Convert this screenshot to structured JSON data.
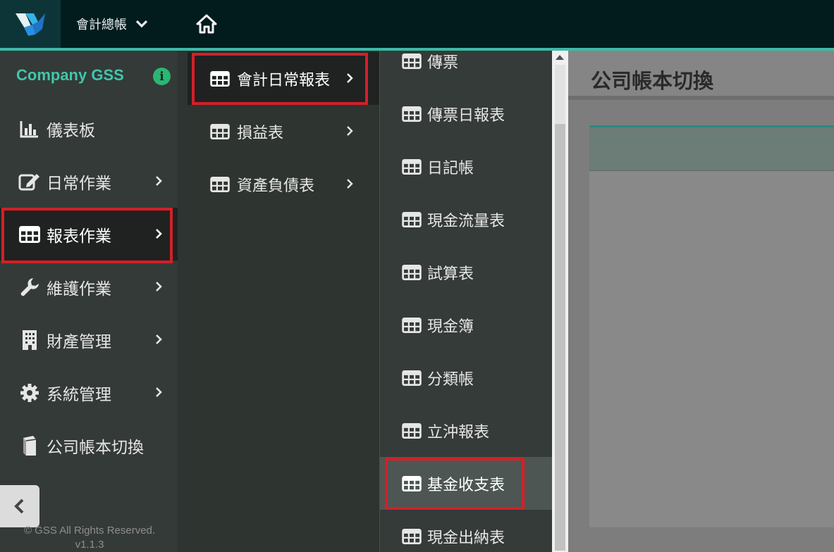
{
  "topbar": {
    "ledger_label": "會計總帳"
  },
  "sidebar": {
    "company": "Company GSS",
    "items": [
      {
        "label": "儀表板"
      },
      {
        "label": "日常作業"
      },
      {
        "label": "報表作業"
      },
      {
        "label": "維護作業"
      },
      {
        "label": "財產管理"
      },
      {
        "label": "系統管理"
      },
      {
        "label": "公司帳本切換"
      }
    ],
    "copyright": "© GSS All Rights Reserved.",
    "version": "v1.1.3"
  },
  "submenu": {
    "items": [
      {
        "label": "會計日常報表"
      },
      {
        "label": "損益表"
      },
      {
        "label": "資產負債表"
      }
    ]
  },
  "reports": {
    "items": [
      {
        "label": "傳票"
      },
      {
        "label": "傳票日報表"
      },
      {
        "label": "日記帳"
      },
      {
        "label": "現金流量表"
      },
      {
        "label": "試算表"
      },
      {
        "label": "現金簿"
      },
      {
        "label": "分類帳"
      },
      {
        "label": "立沖報表"
      },
      {
        "label": "基金收支表"
      },
      {
        "label": "現金出納表"
      }
    ]
  },
  "main": {
    "title": "公司帳本切換"
  },
  "colors": {
    "topbar": "#021c1e",
    "accent": "#3fb9a8",
    "company": "#3fc7ac",
    "highlight": "#d2202a"
  }
}
